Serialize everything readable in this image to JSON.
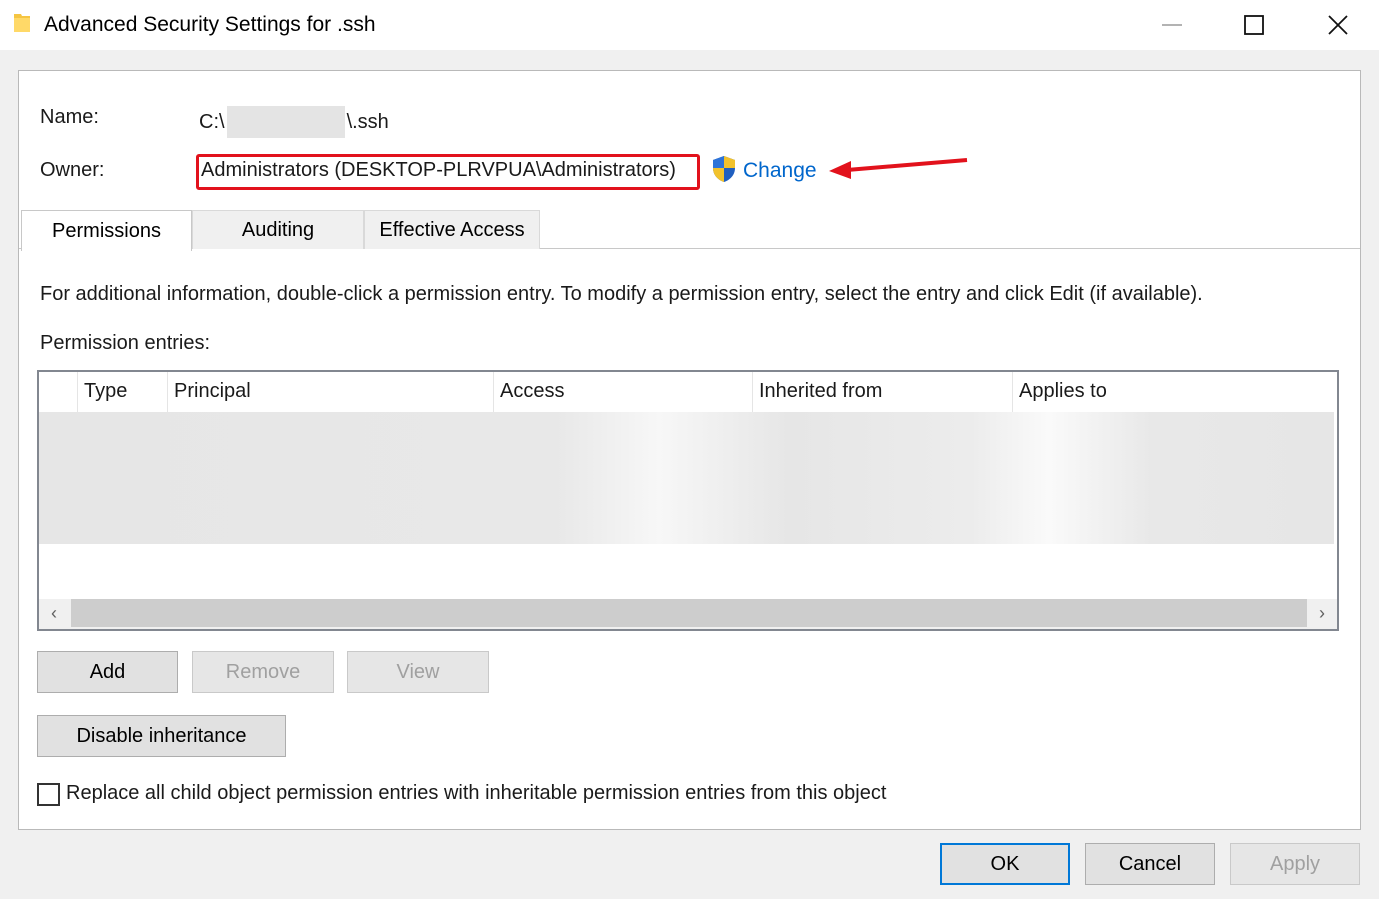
{
  "window": {
    "title": "Advanced Security Settings for .ssh"
  },
  "name": {
    "label": "Name:",
    "value_prefix": "C:\\",
    "value_suffix": "\\.ssh"
  },
  "owner": {
    "label": "Owner:",
    "value": "Administrators (DESKTOP-PLRVPUA\\Administrators)",
    "change_link": "Change"
  },
  "tabs": [
    {
      "label": "Permissions",
      "active": true
    },
    {
      "label": "Auditing",
      "active": false
    },
    {
      "label": "Effective Access",
      "active": false
    }
  ],
  "info_text": "For additional information, double-click a permission entry. To modify a permission entry, select the entry and click Edit (if available).",
  "entries_label": "Permission entries:",
  "grid": {
    "columns": [
      "Type",
      "Principal",
      "Access",
      "Inherited from",
      "Applies to"
    ],
    "scroll_left": "‹",
    "scroll_right": "›"
  },
  "buttons": {
    "add": "Add",
    "remove": "Remove",
    "view": "View",
    "disable_inheritance": "Disable inheritance"
  },
  "checkbox": {
    "label": "Replace all child object permission entries with inheritable permission entries from this object",
    "checked": false
  },
  "footer": {
    "ok": "OK",
    "cancel": "Cancel",
    "apply": "Apply"
  },
  "colors": {
    "link": "#0066cc",
    "annotation_red": "#e2121c",
    "default_button_border": "#0078d7"
  }
}
